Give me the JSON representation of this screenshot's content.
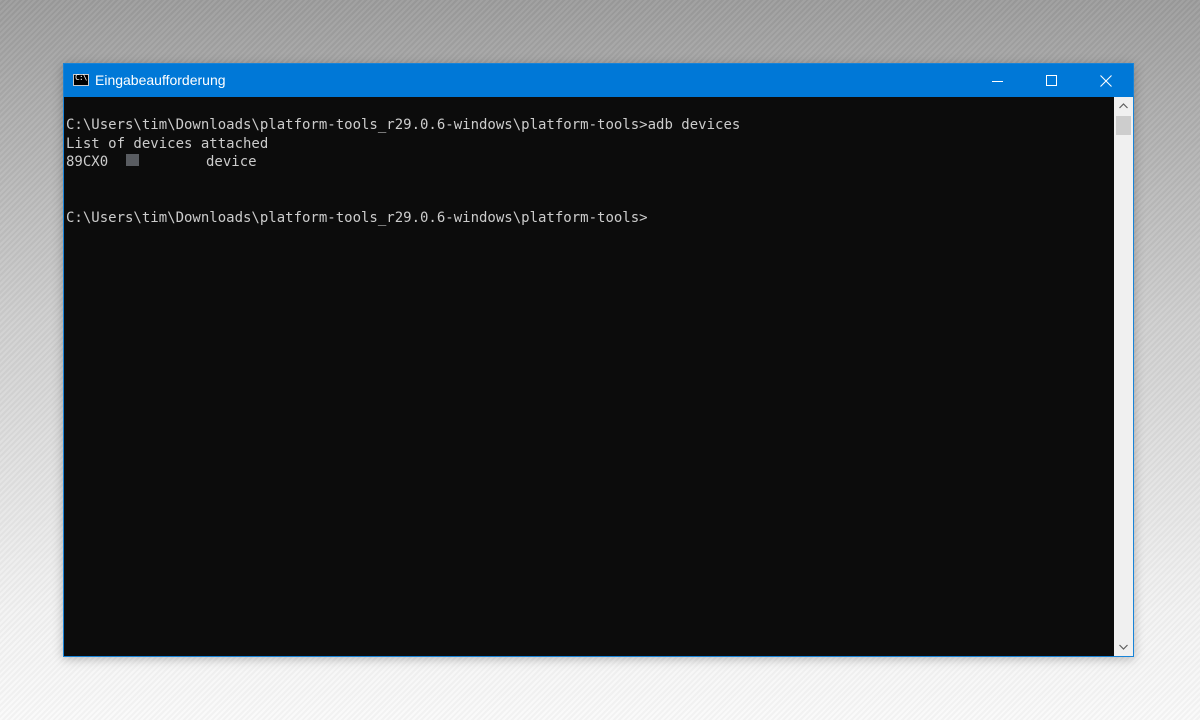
{
  "window": {
    "title": "Eingabeaufforderung",
    "icon": "cmd-icon",
    "icon_glyph": "C:\\",
    "controls": {
      "minimize": "minimize-icon",
      "maximize": "maximize-icon",
      "close": "close-icon"
    },
    "accent_color": "#0078d7"
  },
  "console": {
    "background_color": "#0c0c0c",
    "text_color": "#cccccc",
    "command_line": "C:\\Users\\tim\\Downloads\\platform-tools_r29.0.6-windows\\platform-tools>adb devices",
    "output_header": "List of devices attached",
    "device": {
      "serial": "89CX0",
      "status": "device"
    },
    "prompt": "C:\\Users\\tim\\Downloads\\platform-tools_r29.0.6-windows\\platform-tools>"
  },
  "scrollbar": {
    "up_icon": "chevron-up-icon",
    "down_icon": "chevron-down-icon"
  }
}
